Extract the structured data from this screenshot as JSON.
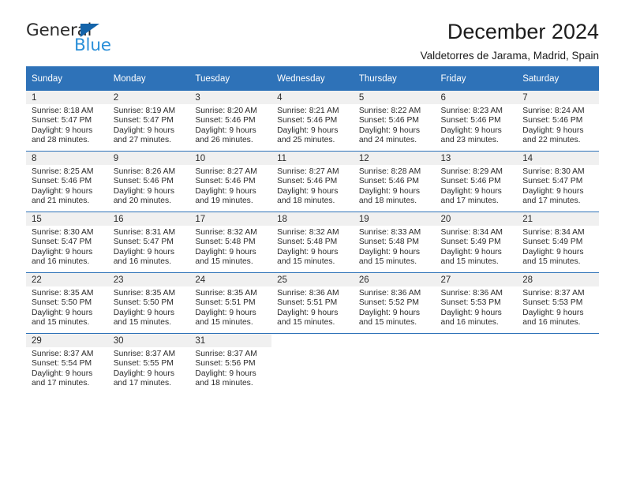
{
  "logo": {
    "word_one": "General",
    "word_two": "Blue",
    "triangle_color": "#1464aa",
    "blue_text_color": "#2a8fd8"
  },
  "header": {
    "title": "December 2024",
    "subtitle": "Valdetorres de Jarama, Madrid, Spain"
  },
  "theme": {
    "header_blue": "#2e72b8",
    "daynum_band": "#f0f0f0",
    "text": "#2b2b2b"
  },
  "calendar": {
    "weekday_headers": [
      "Sunday",
      "Monday",
      "Tuesday",
      "Wednesday",
      "Thursday",
      "Friday",
      "Saturday"
    ],
    "weeks": [
      [
        {
          "day": "1",
          "sunrise": "Sunrise: 8:18 AM",
          "sunset": "Sunset: 5:47 PM",
          "daylight_line1": "Daylight: 9 hours",
          "daylight_line2": "and 28 minutes."
        },
        {
          "day": "2",
          "sunrise": "Sunrise: 8:19 AM",
          "sunset": "Sunset: 5:47 PM",
          "daylight_line1": "Daylight: 9 hours",
          "daylight_line2": "and 27 minutes."
        },
        {
          "day": "3",
          "sunrise": "Sunrise: 8:20 AM",
          "sunset": "Sunset: 5:46 PM",
          "daylight_line1": "Daylight: 9 hours",
          "daylight_line2": "and 26 minutes."
        },
        {
          "day": "4",
          "sunrise": "Sunrise: 8:21 AM",
          "sunset": "Sunset: 5:46 PM",
          "daylight_line1": "Daylight: 9 hours",
          "daylight_line2": "and 25 minutes."
        },
        {
          "day": "5",
          "sunrise": "Sunrise: 8:22 AM",
          "sunset": "Sunset: 5:46 PM",
          "daylight_line1": "Daylight: 9 hours",
          "daylight_line2": "and 24 minutes."
        },
        {
          "day": "6",
          "sunrise": "Sunrise: 8:23 AM",
          "sunset": "Sunset: 5:46 PM",
          "daylight_line1": "Daylight: 9 hours",
          "daylight_line2": "and 23 minutes."
        },
        {
          "day": "7",
          "sunrise": "Sunrise: 8:24 AM",
          "sunset": "Sunset: 5:46 PM",
          "daylight_line1": "Daylight: 9 hours",
          "daylight_line2": "and 22 minutes."
        }
      ],
      [
        {
          "day": "8",
          "sunrise": "Sunrise: 8:25 AM",
          "sunset": "Sunset: 5:46 PM",
          "daylight_line1": "Daylight: 9 hours",
          "daylight_line2": "and 21 minutes."
        },
        {
          "day": "9",
          "sunrise": "Sunrise: 8:26 AM",
          "sunset": "Sunset: 5:46 PM",
          "daylight_line1": "Daylight: 9 hours",
          "daylight_line2": "and 20 minutes."
        },
        {
          "day": "10",
          "sunrise": "Sunrise: 8:27 AM",
          "sunset": "Sunset: 5:46 PM",
          "daylight_line1": "Daylight: 9 hours",
          "daylight_line2": "and 19 minutes."
        },
        {
          "day": "11",
          "sunrise": "Sunrise: 8:27 AM",
          "sunset": "Sunset: 5:46 PM",
          "daylight_line1": "Daylight: 9 hours",
          "daylight_line2": "and 18 minutes."
        },
        {
          "day": "12",
          "sunrise": "Sunrise: 8:28 AM",
          "sunset": "Sunset: 5:46 PM",
          "daylight_line1": "Daylight: 9 hours",
          "daylight_line2": "and 18 minutes."
        },
        {
          "day": "13",
          "sunrise": "Sunrise: 8:29 AM",
          "sunset": "Sunset: 5:46 PM",
          "daylight_line1": "Daylight: 9 hours",
          "daylight_line2": "and 17 minutes."
        },
        {
          "day": "14",
          "sunrise": "Sunrise: 8:30 AM",
          "sunset": "Sunset: 5:47 PM",
          "daylight_line1": "Daylight: 9 hours",
          "daylight_line2": "and 17 minutes."
        }
      ],
      [
        {
          "day": "15",
          "sunrise": "Sunrise: 8:30 AM",
          "sunset": "Sunset: 5:47 PM",
          "daylight_line1": "Daylight: 9 hours",
          "daylight_line2": "and 16 minutes."
        },
        {
          "day": "16",
          "sunrise": "Sunrise: 8:31 AM",
          "sunset": "Sunset: 5:47 PM",
          "daylight_line1": "Daylight: 9 hours",
          "daylight_line2": "and 16 minutes."
        },
        {
          "day": "17",
          "sunrise": "Sunrise: 8:32 AM",
          "sunset": "Sunset: 5:48 PM",
          "daylight_line1": "Daylight: 9 hours",
          "daylight_line2": "and 15 minutes."
        },
        {
          "day": "18",
          "sunrise": "Sunrise: 8:32 AM",
          "sunset": "Sunset: 5:48 PM",
          "daylight_line1": "Daylight: 9 hours",
          "daylight_line2": "and 15 minutes."
        },
        {
          "day": "19",
          "sunrise": "Sunrise: 8:33 AM",
          "sunset": "Sunset: 5:48 PM",
          "daylight_line1": "Daylight: 9 hours",
          "daylight_line2": "and 15 minutes."
        },
        {
          "day": "20",
          "sunrise": "Sunrise: 8:34 AM",
          "sunset": "Sunset: 5:49 PM",
          "daylight_line1": "Daylight: 9 hours",
          "daylight_line2": "and 15 minutes."
        },
        {
          "day": "21",
          "sunrise": "Sunrise: 8:34 AM",
          "sunset": "Sunset: 5:49 PM",
          "daylight_line1": "Daylight: 9 hours",
          "daylight_line2": "and 15 minutes."
        }
      ],
      [
        {
          "day": "22",
          "sunrise": "Sunrise: 8:35 AM",
          "sunset": "Sunset: 5:50 PM",
          "daylight_line1": "Daylight: 9 hours",
          "daylight_line2": "and 15 minutes."
        },
        {
          "day": "23",
          "sunrise": "Sunrise: 8:35 AM",
          "sunset": "Sunset: 5:50 PM",
          "daylight_line1": "Daylight: 9 hours",
          "daylight_line2": "and 15 minutes."
        },
        {
          "day": "24",
          "sunrise": "Sunrise: 8:35 AM",
          "sunset": "Sunset: 5:51 PM",
          "daylight_line1": "Daylight: 9 hours",
          "daylight_line2": "and 15 minutes."
        },
        {
          "day": "25",
          "sunrise": "Sunrise: 8:36 AM",
          "sunset": "Sunset: 5:51 PM",
          "daylight_line1": "Daylight: 9 hours",
          "daylight_line2": "and 15 minutes."
        },
        {
          "day": "26",
          "sunrise": "Sunrise: 8:36 AM",
          "sunset": "Sunset: 5:52 PM",
          "daylight_line1": "Daylight: 9 hours",
          "daylight_line2": "and 15 minutes."
        },
        {
          "day": "27",
          "sunrise": "Sunrise: 8:36 AM",
          "sunset": "Sunset: 5:53 PM",
          "daylight_line1": "Daylight: 9 hours",
          "daylight_line2": "and 16 minutes."
        },
        {
          "day": "28",
          "sunrise": "Sunrise: 8:37 AM",
          "sunset": "Sunset: 5:53 PM",
          "daylight_line1": "Daylight: 9 hours",
          "daylight_line2": "and 16 minutes."
        }
      ],
      [
        {
          "day": "29",
          "sunrise": "Sunrise: 8:37 AM",
          "sunset": "Sunset: 5:54 PM",
          "daylight_line1": "Daylight: 9 hours",
          "daylight_line2": "and 17 minutes."
        },
        {
          "day": "30",
          "sunrise": "Sunrise: 8:37 AM",
          "sunset": "Sunset: 5:55 PM",
          "daylight_line1": "Daylight: 9 hours",
          "daylight_line2": "and 17 minutes."
        },
        {
          "day": "31",
          "sunrise": "Sunrise: 8:37 AM",
          "sunset": "Sunset: 5:56 PM",
          "daylight_line1": "Daylight: 9 hours",
          "daylight_line2": "and 18 minutes."
        },
        {
          "day": "",
          "sunrise": "",
          "sunset": "",
          "daylight_line1": "",
          "daylight_line2": ""
        },
        {
          "day": "",
          "sunrise": "",
          "sunset": "",
          "daylight_line1": "",
          "daylight_line2": ""
        },
        {
          "day": "",
          "sunrise": "",
          "sunset": "",
          "daylight_line1": "",
          "daylight_line2": ""
        },
        {
          "day": "",
          "sunrise": "",
          "sunset": "",
          "daylight_line1": "",
          "daylight_line2": ""
        }
      ]
    ]
  }
}
